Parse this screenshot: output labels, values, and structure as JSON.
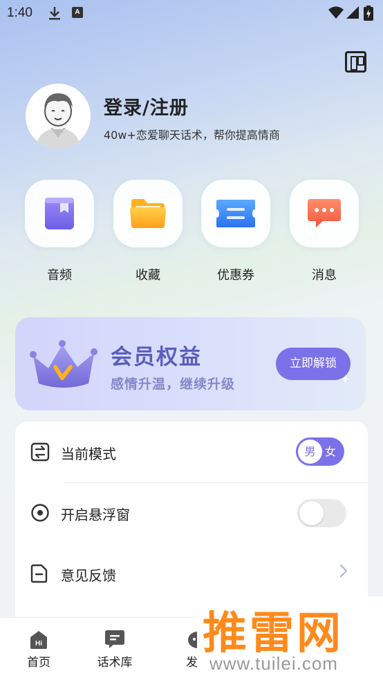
{
  "status_bar": {
    "time": "1:40",
    "a_badge": "A"
  },
  "profile": {
    "title": "登录/注册",
    "subtitle": "40w+恋爱聊天话术，帮你提高情商"
  },
  "quick_actions": [
    {
      "label": "音频",
      "icon": "audio-book-icon"
    },
    {
      "label": "收藏",
      "icon": "folder-icon"
    },
    {
      "label": "优惠券",
      "icon": "coupon-icon"
    },
    {
      "label": "消息",
      "icon": "message-icon"
    }
  ],
  "member": {
    "title": "会员权益",
    "subtitle": "感情升温，继续升级",
    "button": "立即解锁"
  },
  "settings": {
    "mode_label": "当前模式",
    "gender_selected": "男",
    "gender_other": "女",
    "float_label": "开启悬浮窗",
    "feedback_label": "意见反馈"
  },
  "bottom_nav": [
    {
      "label": "首页",
      "icon": "home-icon",
      "badge": "Hi"
    },
    {
      "label": "话术库",
      "icon": "chat-library-icon"
    },
    {
      "label": "发现",
      "icon": "discover-icon"
    }
  ],
  "watermark": {
    "main": "推雷网",
    "url": "www.tuilei.com"
  },
  "colors": {
    "accent": "#7b72e9",
    "member_title": "#5a5ebf",
    "watermark": "#ff8a1c"
  }
}
